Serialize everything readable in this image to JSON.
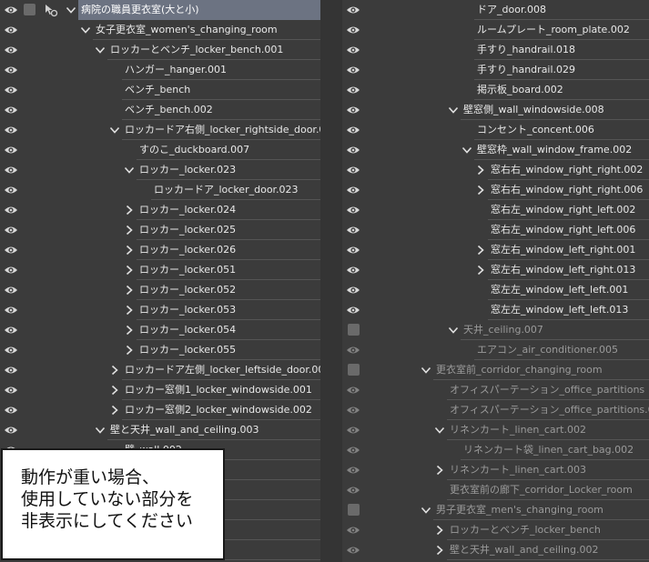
{
  "left": {
    "rows": [
      {
        "label": "病院の職員更衣室(大と小)",
        "level": 0,
        "chevron": "down",
        "selected": true,
        "dim": false
      },
      {
        "label": "女子更衣室_women's_changing_room",
        "level": 1,
        "chevron": "down",
        "selected": false,
        "dim": false
      },
      {
        "label": "ロッカーとベンチ_locker_bench.001",
        "level": 2,
        "chevron": "down",
        "selected": false,
        "dim": false
      },
      {
        "label": "ハンガー_hanger.001",
        "level": 3,
        "chevron": "none",
        "selected": false,
        "dim": false
      },
      {
        "label": "ベンチ_bench",
        "level": 3,
        "chevron": "none",
        "selected": false,
        "dim": false
      },
      {
        "label": "ベンチ_bench.002",
        "level": 3,
        "chevron": "none",
        "selected": false,
        "dim": false
      },
      {
        "label": "ロッカードア右側_locker_rightside_door.001",
        "level": 3,
        "chevron": "down",
        "selected": false,
        "dim": false
      },
      {
        "label": "すのこ_duckboard.007",
        "level": 4,
        "chevron": "none",
        "selected": false,
        "dim": false
      },
      {
        "label": "ロッカー_locker.023",
        "level": 4,
        "chevron": "down",
        "selected": false,
        "dim": false
      },
      {
        "label": "ロッカードア_locker_door.023",
        "level": 5,
        "chevron": "none",
        "selected": false,
        "dim": false
      },
      {
        "label": "ロッカー_locker.024",
        "level": 4,
        "chevron": "right",
        "selected": false,
        "dim": false
      },
      {
        "label": "ロッカー_locker.025",
        "level": 4,
        "chevron": "right",
        "selected": false,
        "dim": false
      },
      {
        "label": "ロッカー_locker.026",
        "level": 4,
        "chevron": "right",
        "selected": false,
        "dim": false
      },
      {
        "label": "ロッカー_locker.051",
        "level": 4,
        "chevron": "right",
        "selected": false,
        "dim": false
      },
      {
        "label": "ロッカー_locker.052",
        "level": 4,
        "chevron": "right",
        "selected": false,
        "dim": false
      },
      {
        "label": "ロッカー_locker.053",
        "level": 4,
        "chevron": "right",
        "selected": false,
        "dim": false
      },
      {
        "label": "ロッカー_locker.054",
        "level": 4,
        "chevron": "right",
        "selected": false,
        "dim": false
      },
      {
        "label": "ロッカー_locker.055",
        "level": 4,
        "chevron": "right",
        "selected": false,
        "dim": false
      },
      {
        "label": "ロッカードア左側_locker_leftside_door.001",
        "level": 3,
        "chevron": "right",
        "selected": false,
        "dim": false
      },
      {
        "label": "ロッカー窓側1_locker_windowside.001",
        "level": 3,
        "chevron": "right",
        "selected": false,
        "dim": false
      },
      {
        "label": "ロッカー窓側2_locker_windowside.002",
        "level": 3,
        "chevron": "right",
        "selected": false,
        "dim": false
      },
      {
        "label": "壁と天井_wall_and_ceiling.003",
        "level": 2,
        "chevron": "down",
        "selected": false,
        "dim": false
      },
      {
        "label": "壁_wall.002",
        "level": 3,
        "chevron": "none",
        "selected": false,
        "dim": false
      },
      {
        "label": "",
        "level": 3,
        "chevron": "none",
        "selected": false,
        "dim": false
      },
      {
        "label": "",
        "level": 3,
        "chevron": "none",
        "selected": false,
        "dim": false
      },
      {
        "label": ".006",
        "level": 3,
        "chevron": "none",
        "selected": false,
        "dim": false
      },
      {
        "label": "",
        "level": 3,
        "chevron": "none",
        "selected": false,
        "dim": false
      },
      {
        "label": "plate.002",
        "level": 3,
        "chevron": "none",
        "selected": false,
        "dim": false
      }
    ]
  },
  "right": {
    "rows": [
      {
        "label": "ドア_door.008",
        "level": 3,
        "chevron": "none",
        "dim": false,
        "box": false
      },
      {
        "label": "ルームプレート_room_plate.002",
        "level": 3,
        "chevron": "none",
        "dim": false,
        "box": false
      },
      {
        "label": "手すり_handrail.018",
        "level": 3,
        "chevron": "none",
        "dim": false,
        "box": false
      },
      {
        "label": "手すり_handrail.029",
        "level": 3,
        "chevron": "none",
        "dim": false,
        "box": false
      },
      {
        "label": "掲示板_board.002",
        "level": 3,
        "chevron": "none",
        "dim": false,
        "box": false
      },
      {
        "label": "壁窓側_wall_windowside.008",
        "level": 2,
        "chevron": "down",
        "dim": false,
        "box": false
      },
      {
        "label": "コンセント_concent.006",
        "level": 3,
        "chevron": "none",
        "dim": false,
        "box": false
      },
      {
        "label": "壁窓枠_wall_window_frame.002",
        "level": 3,
        "chevron": "down",
        "dim": false,
        "box": false
      },
      {
        "label": "窓右右_window_right_right.002",
        "level": 4,
        "chevron": "right",
        "dim": false,
        "box": false
      },
      {
        "label": "窓右右_window_right_right.006",
        "level": 4,
        "chevron": "right",
        "dim": false,
        "box": false
      },
      {
        "label": "窓右左_window_right_left.002",
        "level": 4,
        "chevron": "none",
        "dim": false,
        "box": false
      },
      {
        "label": "窓右左_window_right_left.006",
        "level": 4,
        "chevron": "none",
        "dim": false,
        "box": false
      },
      {
        "label": "窓左右_window_left_right.001",
        "level": 4,
        "chevron": "right",
        "dim": false,
        "box": false
      },
      {
        "label": "窓左右_window_left_right.013",
        "level": 4,
        "chevron": "right",
        "dim": false,
        "box": false
      },
      {
        "label": "窓左左_window_left_left.001",
        "level": 4,
        "chevron": "none",
        "dim": false,
        "box": false
      },
      {
        "label": "窓左左_window_left_left.013",
        "level": 4,
        "chevron": "none",
        "dim": false,
        "box": false
      },
      {
        "label": "天井_ceiling.007",
        "level": 2,
        "chevron": "down",
        "dim": true,
        "box": true
      },
      {
        "label": "エアコン_air_conditioner.005",
        "level": 3,
        "chevron": "none",
        "dim": true,
        "box": false
      },
      {
        "label": "更衣室前_corridor_changing_room",
        "level": 0,
        "chevron": "down",
        "dim": true,
        "box": true
      },
      {
        "label": "オフィスパーテーション_office_partitions",
        "level": 1,
        "chevron": "none",
        "dim": true,
        "box": false
      },
      {
        "label": "オフィスパーテーション_office_partitions.001",
        "level": 1,
        "chevron": "none",
        "dim": true,
        "box": false
      },
      {
        "label": "リネンカート_linen_cart.002",
        "level": 1,
        "chevron": "down",
        "dim": true,
        "box": false
      },
      {
        "label": "リネンカート袋_linen_cart_bag.002",
        "level": 2,
        "chevron": "none",
        "dim": true,
        "box": false
      },
      {
        "label": "リネンカート_linen_cart.003",
        "level": 1,
        "chevron": "right",
        "dim": true,
        "box": false
      },
      {
        "label": "更衣室前の廊下_corridor_Locker_room",
        "level": 1,
        "chevron": "none",
        "dim": true,
        "box": false
      },
      {
        "label": "男子更衣室_men's_changing_room",
        "level": 0,
        "chevron": "down",
        "dim": true,
        "box": true
      },
      {
        "label": "ロッカーとベンチ_locker_bench",
        "level": 1,
        "chevron": "right",
        "dim": true,
        "box": false
      },
      {
        "label": "壁と天井_wall_and_ceiling.002",
        "level": 1,
        "chevron": "right",
        "dim": true,
        "box": false
      }
    ]
  },
  "popup": {
    "lines": [
      "動作が重い場合、",
      "使用していない部分を",
      "非表示にしてください"
    ]
  },
  "colors": {
    "background": "#3b3b3b",
    "selected": "#6c7382",
    "separator": "#555555"
  },
  "icons": {
    "visibility": "eye-icon",
    "expand": "chevron-down-icon",
    "collapse": "chevron-right-icon",
    "selectable": "pointer-pen-icon",
    "lock": "checkbox-icon"
  }
}
